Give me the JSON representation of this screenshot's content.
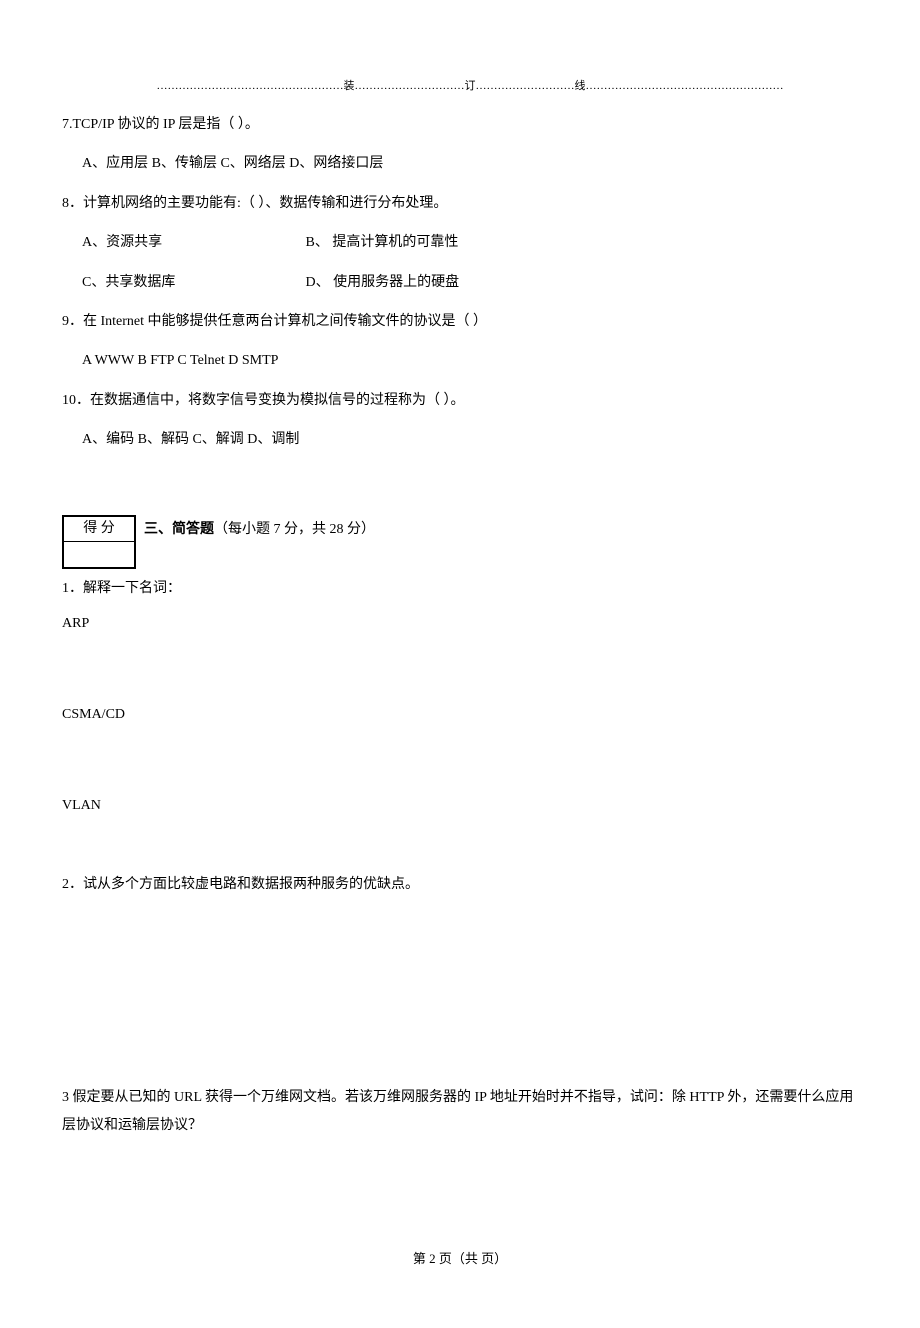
{
  "binding": {
    "dots_left": "……………………………………………",
    "z": "装",
    "dots_mid1": "…………………………",
    "d": "订",
    "dots_mid2": "………………………",
    "x": "线",
    "dots_right": "………………………………………………"
  },
  "q7": {
    "text": "7.TCP/IP 协议的 IP 层是指（   ）。",
    "opts": "A、应用层   B、传输层   C、网络层   D、网络接口层"
  },
  "q8": {
    "text": "8．计算机网络的主要功能有:（    ）、数据传输和进行分布处理。",
    "a": "A、资源共享",
    "b": "B、 提高计算机的可靠性",
    "c": "C、共享数据库",
    "d": "D、 使用服务器上的硬盘"
  },
  "q9": {
    "text": "9．在 Internet 中能够提供任意两台计算机之间传输文件的协议是（    ）",
    "opts": "A  WWW     B FTP     C Telnet     D SMTP"
  },
  "q10": {
    "text": "10．在数据通信中，将数字信号变换为模拟信号的过程称为（   ）。",
    "opts": "A、编码       B、解码        C、解调        D、调制"
  },
  "section3": {
    "score_label": "得  分",
    "title_bold": "三、简答题",
    "title_rest": "（每小题 7 分，共 28 分）"
  },
  "sq1": {
    "text": "1．解释一下名词：",
    "term1": "ARP",
    "term2": "CSMA/CD",
    "term3": "VLAN"
  },
  "sq2": {
    "text": "2．试从多个方面比较虚电路和数据报两种服务的优缺点。"
  },
  "sq3": {
    "text": "3 假定要从已知的 URL 获得一个万维网文档。若该万维网服务器的 IP 地址开始时并不指导，试问：除 HTTP 外，还需要什么应用层协议和运输层协议？"
  },
  "footer": "第 2 页（共  页）"
}
